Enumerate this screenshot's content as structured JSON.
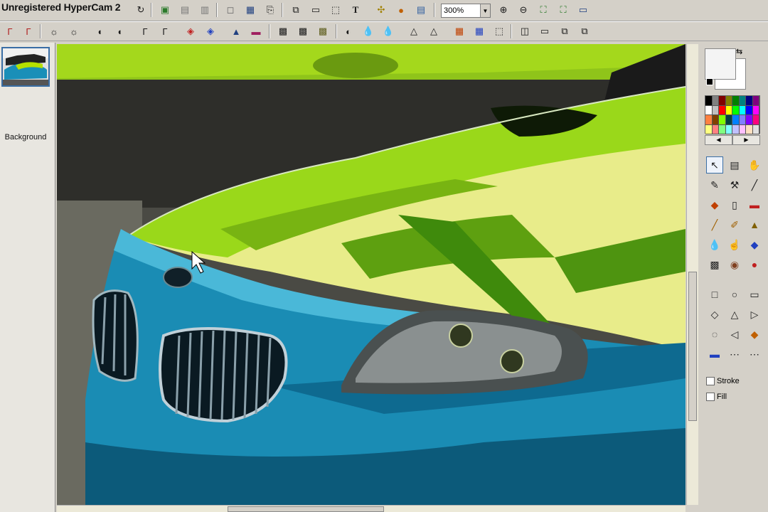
{
  "recorder_watermark": "Unregistered HyperCam 2",
  "toolbar": {
    "zoom_value": "300%",
    "row1_icons": [
      "new-icon",
      "open-icon",
      "save-icon",
      "undo-icon",
      "redo-icon",
      "import-icon",
      "export-icon",
      "print-icon",
      "crop-icon",
      "image-icon",
      "paste-icon",
      "copy-icon",
      "select-icon",
      "text-icon",
      "effects-icon",
      "color-icon",
      "layout-icon",
      "zoom-in-icon",
      "zoom-out-icon",
      "fit-window-icon",
      "actual-size-icon",
      "fullscreen-icon"
    ],
    "row2_icons": [
      "rotate-left-icon",
      "rotate-right-icon",
      "brightness-icon",
      "contrast-icon",
      "levels-icon",
      "curves-icon",
      "gamma-icon",
      "hue-icon",
      "saturation-icon",
      "colorize-icon",
      "grayscale-icon",
      "invert-icon",
      "posterize-icon",
      "blur-icon",
      "sharpen-icon",
      "soften-icon",
      "emboss-icon",
      "edge-icon",
      "noise-icon",
      "red-eye-icon",
      "color-balance-icon",
      "histogram-icon",
      "page-icon",
      "frame-icon",
      "shadow-icon",
      "merge-icon"
    ]
  },
  "layers": {
    "items": [
      {
        "label": "Background"
      }
    ]
  },
  "tools": {
    "colors": {
      "primary": "#f4f4f4",
      "secondary": "#ffffff",
      "palette": [
        "#000000",
        "#808080",
        "#800000",
        "#808000",
        "#008000",
        "#008080",
        "#000080",
        "#800080",
        "#ffffff",
        "#c0c0c0",
        "#ff0000",
        "#ffff00",
        "#00ff00",
        "#00ffff",
        "#0000ff",
        "#ff00ff",
        "#ff8040",
        "#804000",
        "#80ff00",
        "#004040",
        "#0080ff",
        "#8080ff",
        "#8000ff",
        "#ff0080",
        "#ffff80",
        "#ff8080",
        "#80ff80",
        "#80ffff",
        "#c0c0ff",
        "#ffc0ff",
        "#ffe0c0",
        "#e0e0e0"
      ]
    },
    "stroke_label": "Stroke",
    "fill_label": "Fill"
  },
  "accent_color": "#3a6ea5"
}
